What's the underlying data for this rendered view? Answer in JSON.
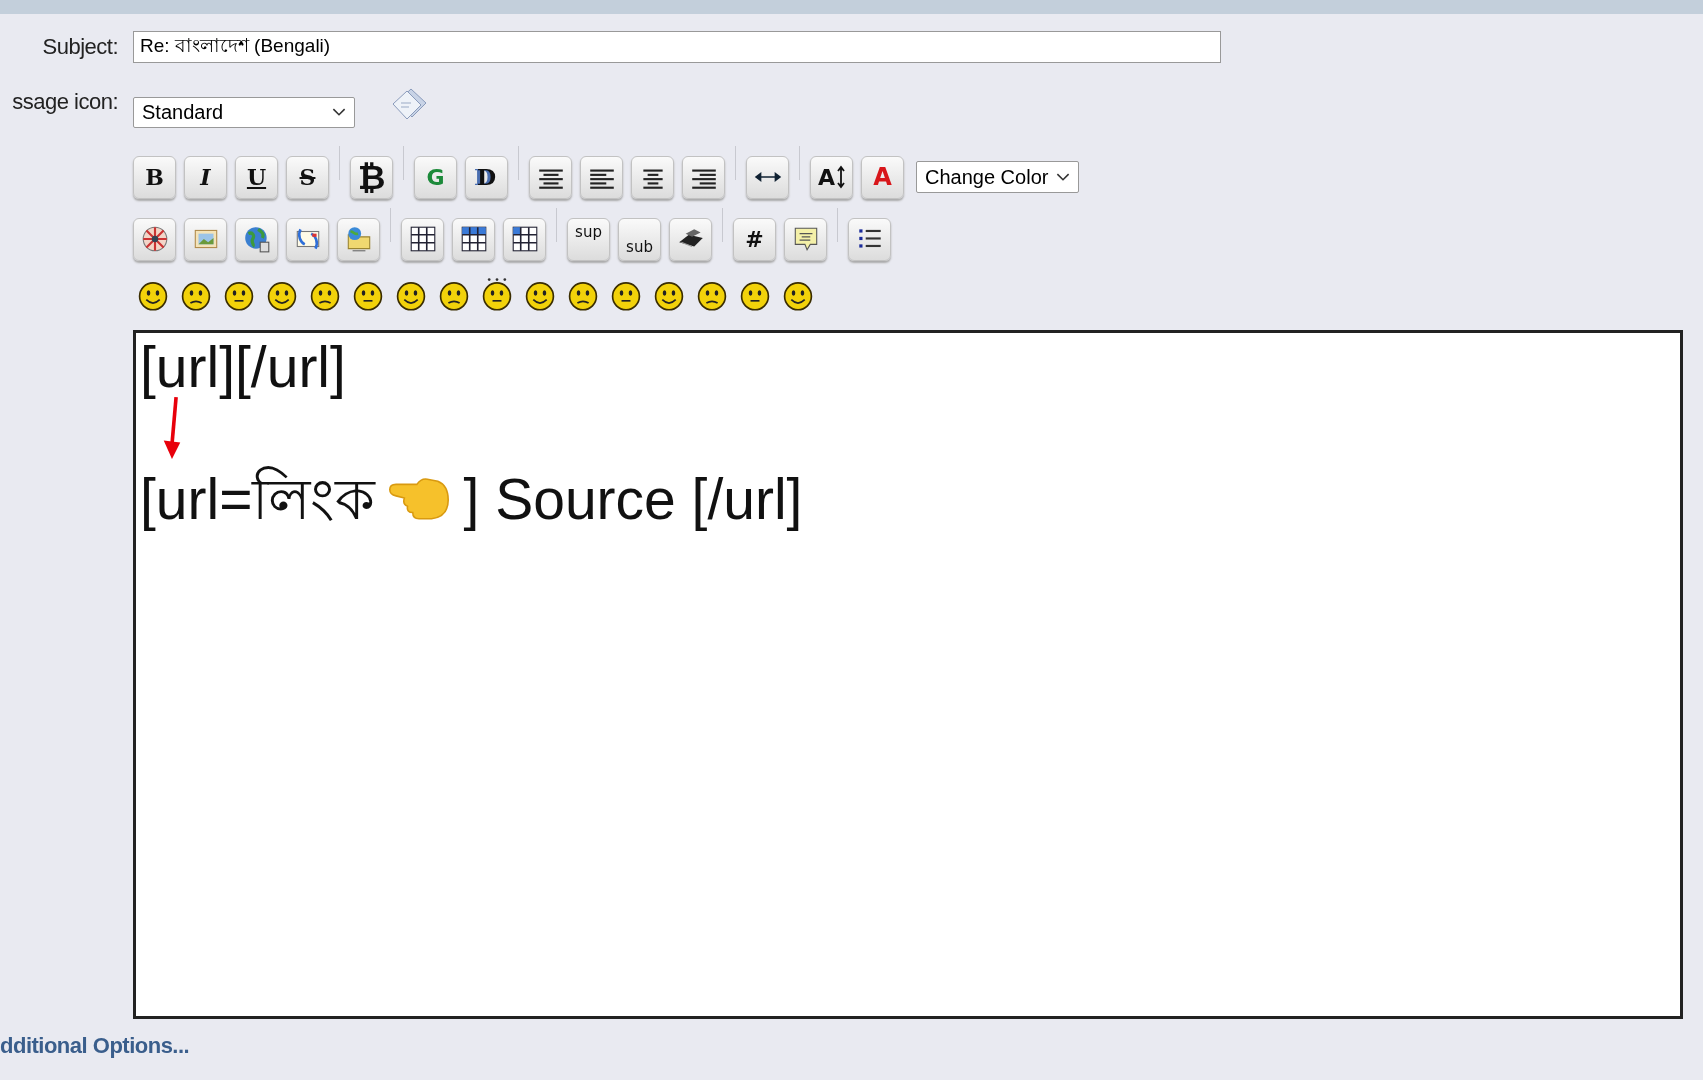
{
  "subject": {
    "label": "Subject:",
    "value": "Re: বাংলাদেশ (Bengali)"
  },
  "message_icon": {
    "label": "ssage icon:",
    "value": "Standard"
  },
  "toolbar_row_1": [
    {
      "kind": "text",
      "label": "B"
    },
    {
      "kind": "text",
      "label": "I"
    },
    {
      "kind": "text",
      "label": "U"
    },
    {
      "kind": "text",
      "label": "S"
    },
    {
      "kind": "separator"
    },
    {
      "kind": "text",
      "label": "₿"
    },
    {
      "kind": "separator"
    },
    {
      "kind": "text",
      "label": "G"
    },
    {
      "kind": "text",
      "label": "D"
    },
    {
      "kind": "separator"
    },
    {
      "kind": "icon"
    },
    {
      "kind": "icon"
    },
    {
      "kind": "icon"
    },
    {
      "kind": "icon"
    },
    {
      "kind": "separator"
    },
    {
      "kind": "icon"
    },
    {
      "kind": "separator"
    },
    {
      "kind": "text",
      "label": "A"
    },
    {
      "kind": "text",
      "label": "A"
    },
    {
      "kind": "select",
      "label": "Change Color"
    }
  ],
  "toolbar_row_2": [
    {
      "kind": "icon"
    },
    {
      "kind": "icon"
    },
    {
      "kind": "icon"
    },
    {
      "kind": "icon"
    },
    {
      "kind": "icon"
    },
    {
      "kind": "separator"
    },
    {
      "kind": "icon"
    },
    {
      "kind": "icon"
    },
    {
      "kind": "icon"
    },
    {
      "kind": "separator"
    },
    {
      "kind": "text",
      "label": "sup"
    },
    {
      "kind": "text",
      "label": "sub"
    },
    {
      "kind": "icon"
    },
    {
      "kind": "separator"
    },
    {
      "kind": "text",
      "label": "#"
    },
    {
      "kind": "icon"
    },
    {
      "kind": "separator"
    },
    {
      "kind": "icon"
    }
  ],
  "editor": {
    "line_1": "[url][/url]",
    "line_2_before": "[url=লিংক",
    "line_2_after": "] Source [/url]"
  },
  "additional_options": "dditional Options..."
}
